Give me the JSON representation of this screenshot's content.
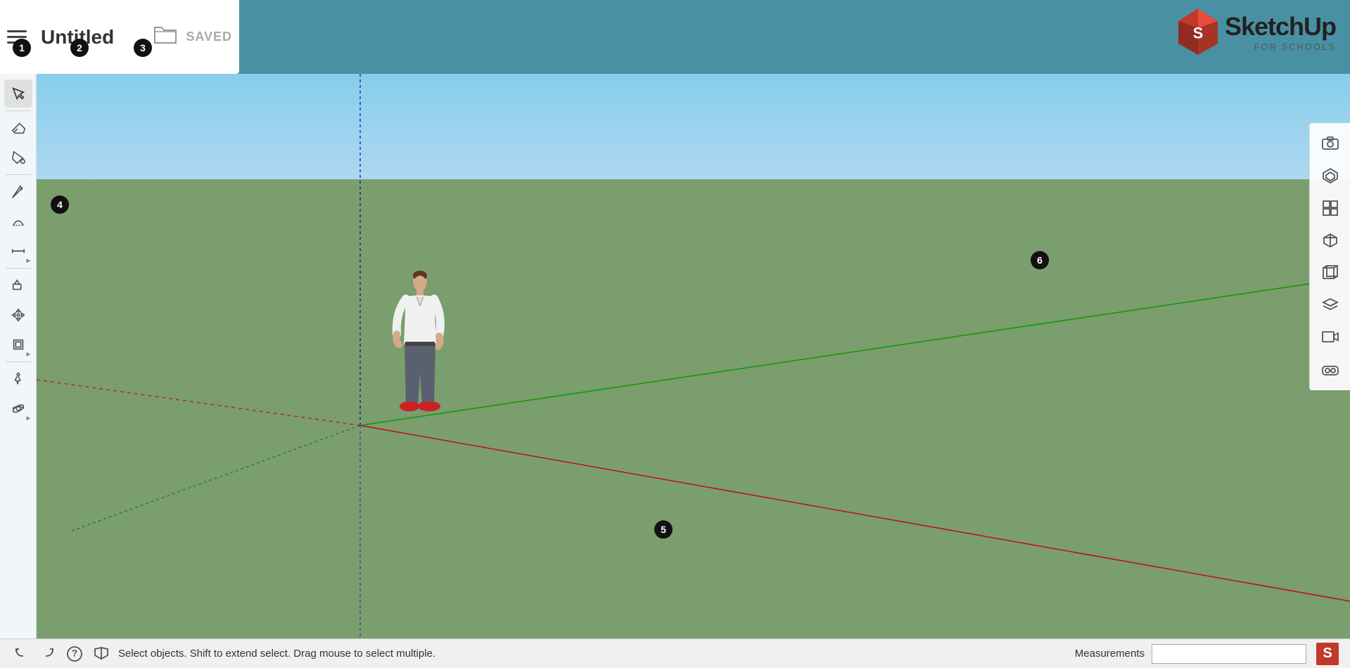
{
  "header": {
    "title": "Untitled",
    "saved_label": "SAVED",
    "menu_icon": "menu-icon",
    "folder_icon": "folder-icon"
  },
  "logo": {
    "sketchup": "SketchUp",
    "for_schools": "FOR SCHOOLS"
  },
  "badges": {
    "b1": "1",
    "b2": "2",
    "b3": "3",
    "b4": "4",
    "b5": "5",
    "b6": "6"
  },
  "bottom_bar": {
    "status_text": "Select objects. Shift to extend select. Drag mouse to select multiple.",
    "measurements_label": "Measurements"
  },
  "tools": {
    "select": "Select",
    "eraser": "Eraser",
    "paint": "Paint Bucket",
    "pencil": "Pencil",
    "arc": "Arc",
    "measure": "Measure",
    "push_pull": "Push/Pull",
    "move": "Move",
    "offset": "Offset",
    "walk": "Walk",
    "orbit": "Orbit"
  },
  "views": {
    "camera": "Camera",
    "scenes": "Scenes",
    "components": "Components",
    "iso": "Isometric",
    "front": "Front View",
    "layers": "Layers",
    "video": "Video",
    "vr": "VR"
  }
}
